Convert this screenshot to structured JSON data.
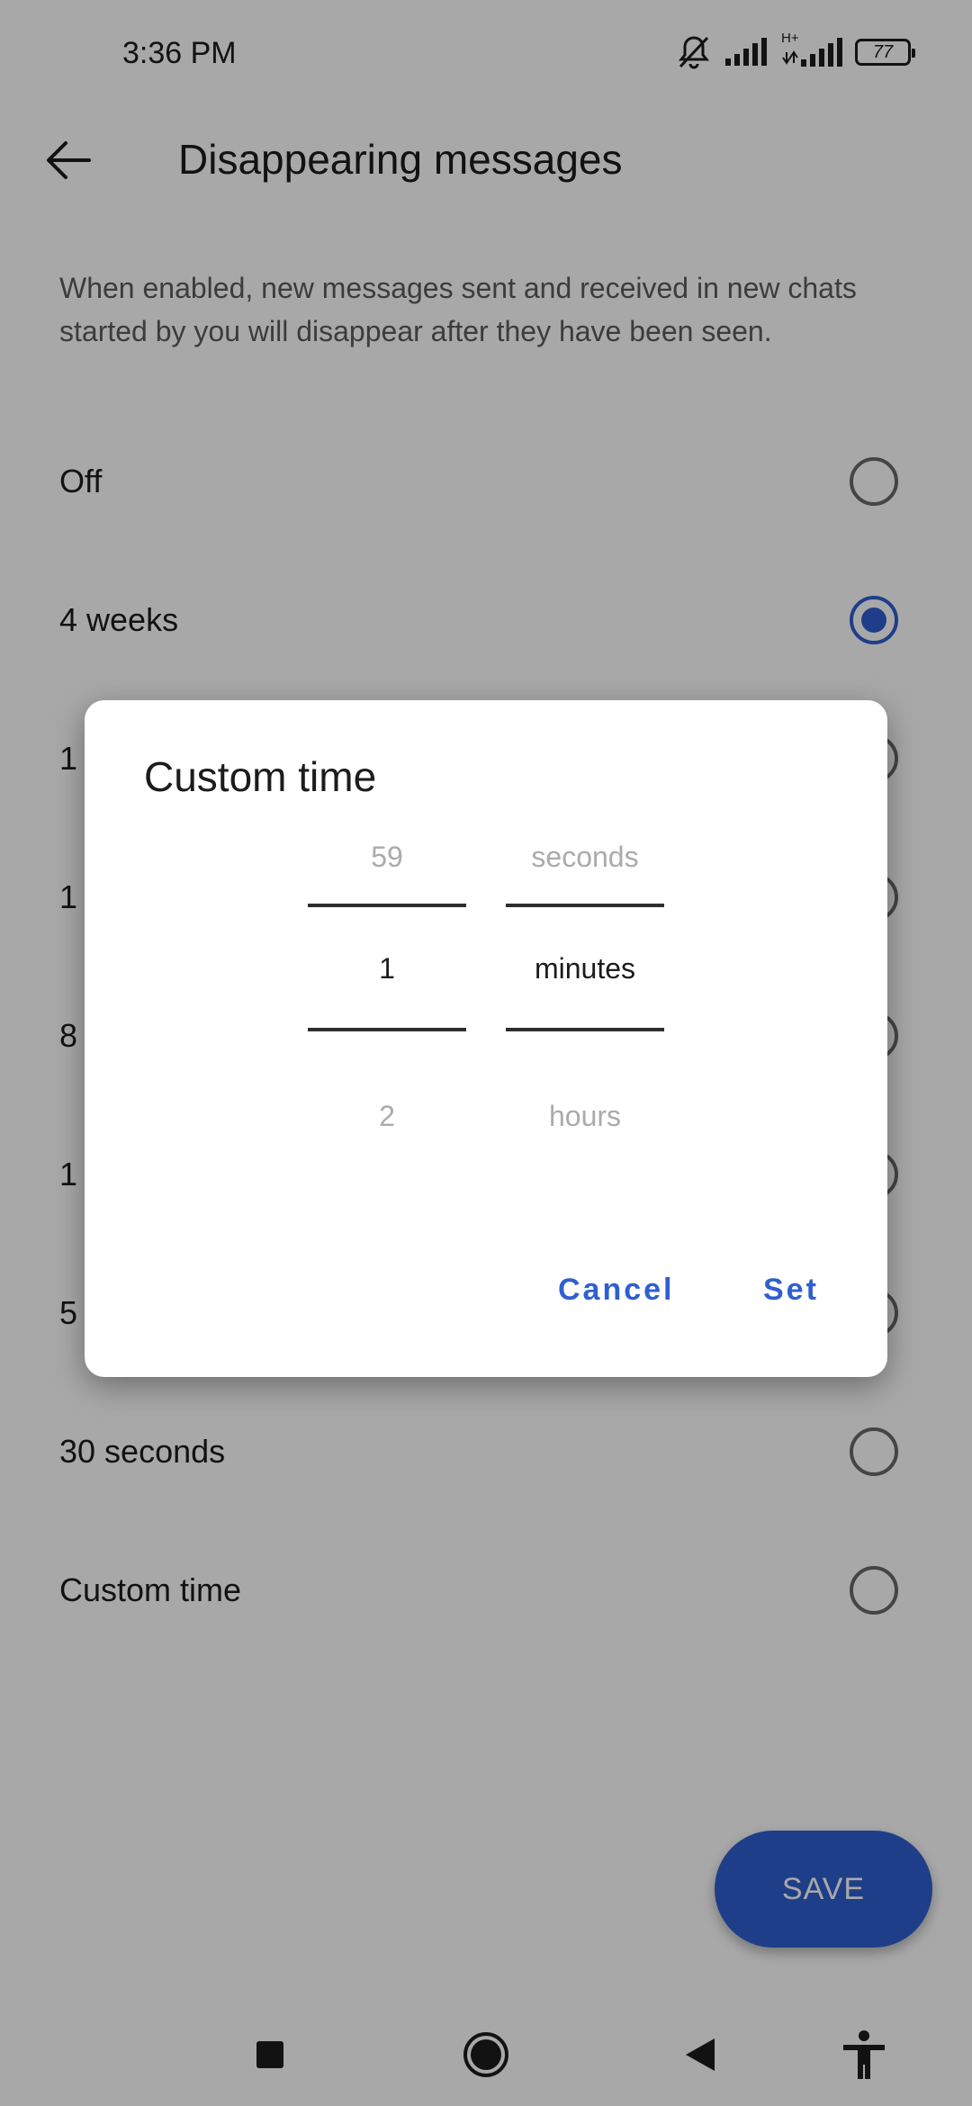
{
  "status_bar": {
    "time": "3:36 PM",
    "battery_level": "77",
    "network_label": "H+",
    "icons": [
      "bell-muted-icon",
      "signal-icon",
      "signal-h-plus-icon",
      "battery-icon"
    ]
  },
  "header": {
    "title": "Disappearing messages",
    "back_icon": "arrow-left-icon"
  },
  "description": "When enabled, new messages sent and received in new chats started by you will disappear after they have been seen.",
  "options": [
    {
      "label": "Off",
      "selected": false
    },
    {
      "label": "4 weeks",
      "selected": true
    },
    {
      "label": "1",
      "selected": false
    },
    {
      "label": "1",
      "selected": false
    },
    {
      "label": "8",
      "selected": false
    },
    {
      "label": "1",
      "selected": false
    },
    {
      "label": "5",
      "selected": false
    },
    {
      "label": "30 seconds",
      "selected": false
    },
    {
      "label": "Custom time",
      "selected": false
    }
  ],
  "save_label": "SAVE",
  "dialog": {
    "title": "Custom time",
    "number_picker": {
      "prev": "59",
      "current": "1",
      "next": "2"
    },
    "unit_picker": {
      "prev": "seconds",
      "current": "minutes",
      "next": "hours"
    },
    "cancel_label": "Cancel",
    "set_label": "Set"
  },
  "nav_bar": {
    "icons": [
      "square-icon",
      "circle-icon",
      "triangle-back-icon",
      "accessibility-icon"
    ]
  },
  "colors": {
    "accent": "#2f5fd0",
    "scrim": "rgba(0,0,0,0.34)",
    "text_primary": "#1c1c1c",
    "text_secondary": "#5b5b5b"
  }
}
